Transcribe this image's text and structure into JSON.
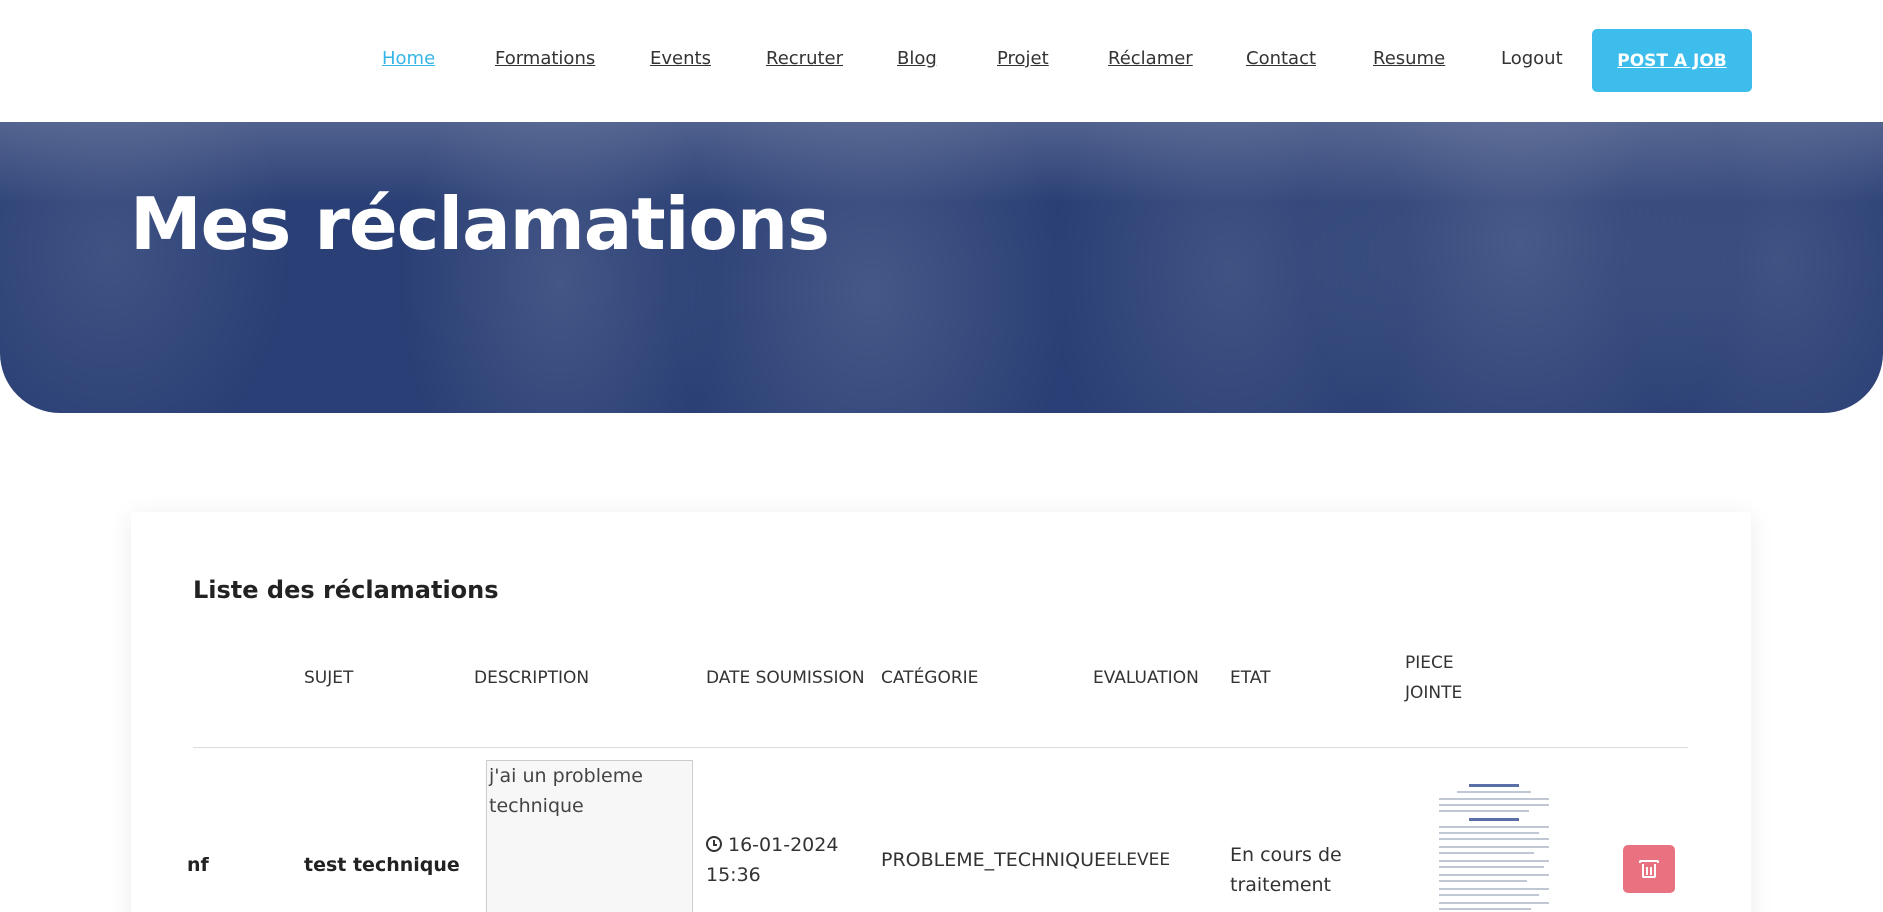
{
  "nav": {
    "items": [
      "Home",
      "Formations",
      "Events",
      "Recruter",
      "Blog",
      "Projet",
      "Réclamer",
      "Contact",
      "Resume",
      "Logout"
    ],
    "active": "Home",
    "post_job_label": "POST A JOB"
  },
  "hero": {
    "title": "Mes réclamations"
  },
  "card": {
    "title": "Liste des réclamations"
  },
  "table": {
    "headers": {
      "sujet": "SUJET",
      "description": "DESCRIPTION",
      "date": "DATE SOUMISSION",
      "categorie": "CATÉGORIE",
      "evaluation": "EVALUATION",
      "etat": "ETAT",
      "piece_line1": "PIECE",
      "piece_line2": "JOINTE"
    },
    "rows": [
      {
        "first_col_fragment": "nf",
        "sujet": "test technique",
        "description": "j'ai un probleme technique",
        "date_line1": "16-01-2024",
        "date_line2": "15:36",
        "categorie": "PROBLEME_TECHNIQUE",
        "evaluation": "ELEVEE",
        "etat_line1": "En cours de",
        "etat_line2": "traitement"
      }
    ]
  },
  "colors": {
    "accent": "#3cbdeb",
    "hero": "#2a3f75",
    "delete": "#e8727f"
  }
}
